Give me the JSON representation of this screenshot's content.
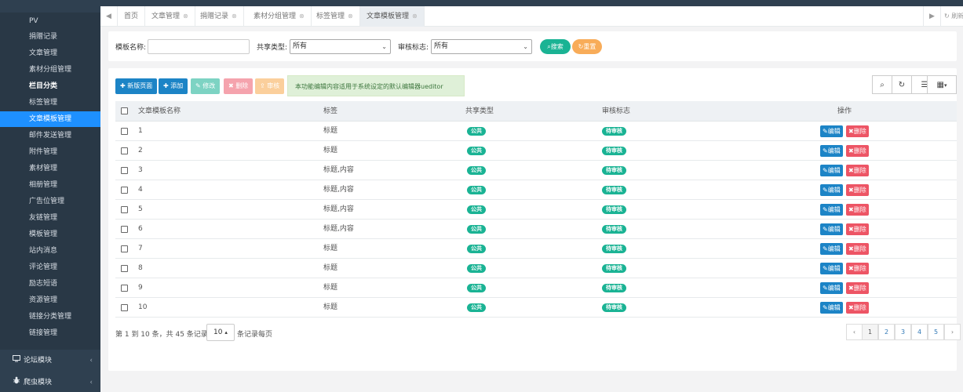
{
  "topbar": {
    "right_texts": [
      "",
      "",
      ""
    ],
    "user": ""
  },
  "sidebar": {
    "items": [
      {
        "label": "PV"
      },
      {
        "label": "捐赠记录"
      },
      {
        "label": "文章管理"
      },
      {
        "label": "素材分组管理"
      },
      {
        "label": "栏目分类",
        "bold": true
      },
      {
        "label": "标签管理"
      },
      {
        "label": "文章模板管理",
        "active": true
      },
      {
        "label": "邮件发送管理"
      },
      {
        "label": "附件管理"
      },
      {
        "label": "素材管理"
      },
      {
        "label": "相册管理"
      },
      {
        "label": "广告位管理"
      },
      {
        "label": "友链管理"
      },
      {
        "label": "模板管理"
      },
      {
        "label": "站内消息"
      },
      {
        "label": "评论管理"
      },
      {
        "label": "励志短语"
      },
      {
        "label": "资源管理"
      },
      {
        "label": "链接分类管理"
      },
      {
        "label": "链接管理"
      }
    ],
    "groups": [
      {
        "label": "论坛模块",
        "icon": "monitor-icon"
      },
      {
        "label": "爬虫模块",
        "icon": "bug-icon"
      }
    ]
  },
  "tabs": {
    "items": [
      {
        "label": "首页",
        "closable": false
      },
      {
        "label": "文章管理",
        "closable": true
      },
      {
        "label": "捐赠记录",
        "closable": true
      },
      {
        "label": "素材分组管理",
        "closable": true
      },
      {
        "label": "标签管理",
        "closable": true
      },
      {
        "label": "文章模板管理",
        "closable": true,
        "active": true
      }
    ],
    "refresh_label": "刷新"
  },
  "search": {
    "name_label": "模板名称:",
    "name_value": "",
    "share_label": "共享类型:",
    "share_value": "所有",
    "audit_label": "审核标志:",
    "audit_value": "所有",
    "search_btn": "搜索",
    "reset_btn": "重置"
  },
  "toolbar": {
    "new_page": "新版页面",
    "add": "添加",
    "edit": "修改",
    "delete": "删除",
    "audit": "审核",
    "notice": "本功能编辑内容适用于系统设定的默认编辑器ueditor"
  },
  "table": {
    "columns": [
      "文章模板名称",
      "标签",
      "共享类型",
      "审核标志",
      "操作"
    ],
    "rows": [
      {
        "name": "1",
        "tags": "标题",
        "share": "公共",
        "audit": "待审核"
      },
      {
        "name": "2",
        "tags": "标题",
        "share": "公共",
        "audit": "待审核"
      },
      {
        "name": "3",
        "tags": "标题,内容",
        "share": "公共",
        "audit": "待审核"
      },
      {
        "name": "4",
        "tags": "标题,内容",
        "share": "公共",
        "audit": "待审核"
      },
      {
        "name": "5",
        "tags": "标题,内容",
        "share": "公共",
        "audit": "待审核"
      },
      {
        "name": "6",
        "tags": "标题,内容",
        "share": "公共",
        "audit": "待审核"
      },
      {
        "name": "7",
        "tags": "标题",
        "share": "公共",
        "audit": "待审核"
      },
      {
        "name": "8",
        "tags": "标题",
        "share": "公共",
        "audit": "待审核"
      },
      {
        "name": "9",
        "tags": "标题",
        "share": "公共",
        "audit": "待审核"
      },
      {
        "name": "10",
        "tags": "标题",
        "share": "公共",
        "audit": "待审核"
      }
    ],
    "edit_label": "编辑",
    "delete_label": "删除"
  },
  "pagination": {
    "info": "第 1 到 10 条，共 45 条记录。",
    "page_size": "10",
    "per_page_label": "条记录每页",
    "prev": "‹",
    "next": "›",
    "pages": [
      "1",
      "2",
      "3",
      "4",
      "5"
    ],
    "current": "1"
  },
  "colors": {
    "sidebar_bg": "#2f4050",
    "active_menu": "#1e90ff",
    "primary": "#1c84c6",
    "success": "#1ab394",
    "danger": "#ed5565",
    "warning": "#f8ac59"
  }
}
